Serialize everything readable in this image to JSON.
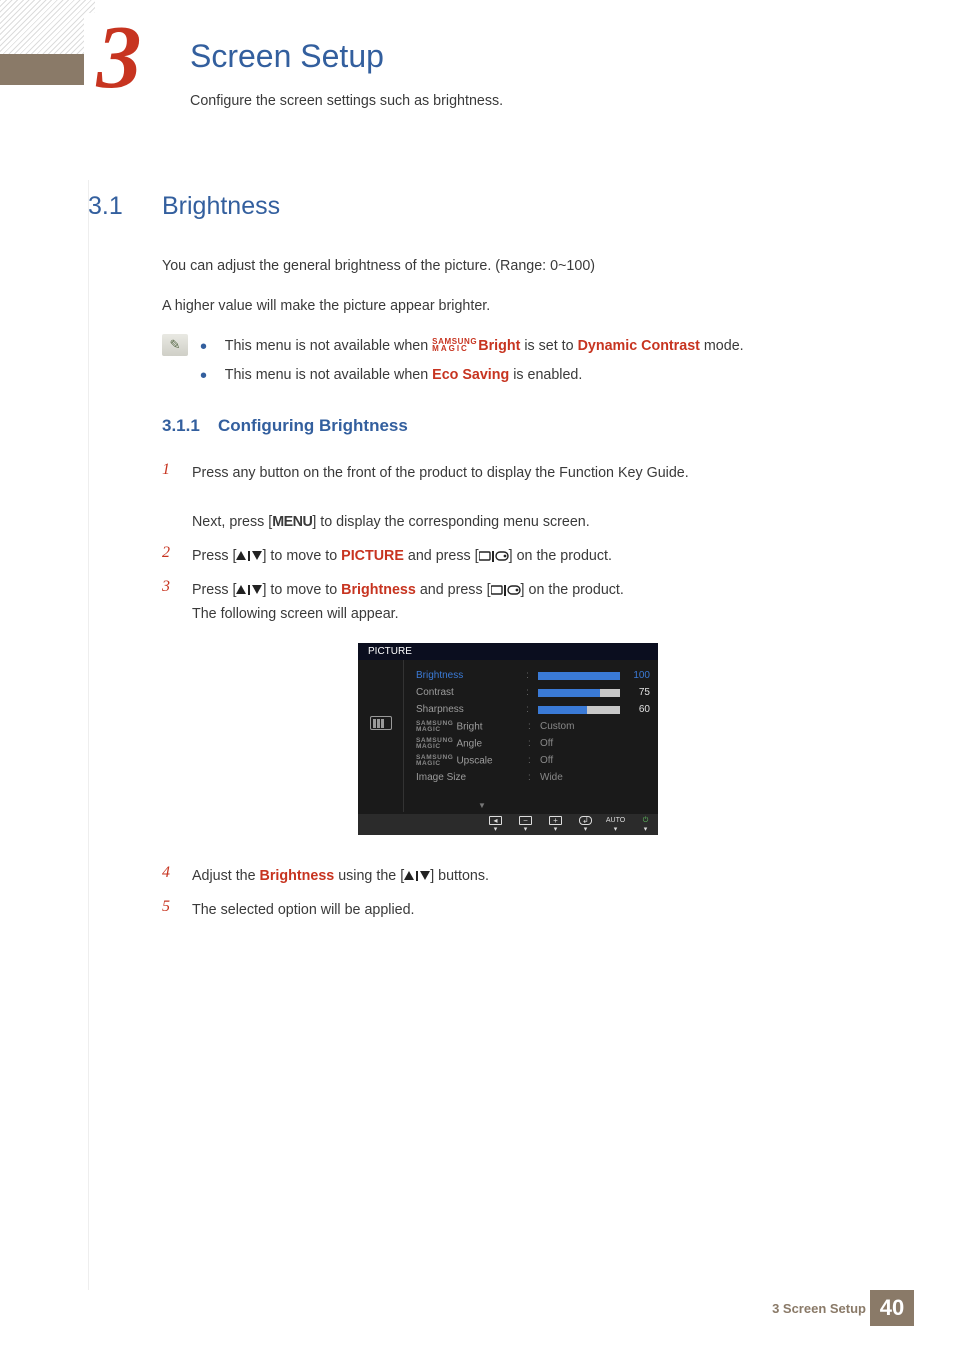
{
  "chapter": {
    "number": "3",
    "title": "Screen Setup",
    "subtitle": "Configure the screen settings such as brightness."
  },
  "section": {
    "number": "3.1",
    "title": "Brightness"
  },
  "para1": "You can adjust the general brightness of the picture. (Range: 0~100)",
  "para2": "A higher value will make the picture appear brighter.",
  "notes": {
    "n1a": "This menu is not available when ",
    "n1_bright": "Bright",
    "n1b": " is set to ",
    "n1_dyn": "Dynamic Contrast",
    "n1c": " mode.",
    "n2a": "This menu is not available when ",
    "n2_eco": "Eco Saving",
    "n2b": " is enabled."
  },
  "subsec": {
    "number": "3.1.1",
    "title": "Configuring Brightness"
  },
  "steps": {
    "s1a": "Press any button on the front of the product to display the Function Key Guide.",
    "s1b_pre": "Next, press [",
    "s1b_menu": "MENU",
    "s1b_post": "] to display the corresponding menu screen.",
    "s2_pre": "Press [",
    "s2_mid": "] to move to ",
    "s2_pic": "PICTURE",
    "s2_and": " and press [",
    "s2_post": "] on the product.",
    "s3_pre": "Press [",
    "s3_mid": "] to move to ",
    "s3_bri": "Brightness",
    "s3_and": " and press [",
    "s3_post": "] on the product.",
    "s3_foll": "The following screen will appear.",
    "s4_pre": "Adjust the ",
    "s4_bri": "Brightness",
    "s4_mid": " using the [",
    "s4_post": "] buttons.",
    "s5": "The selected option will be applied."
  },
  "osd": {
    "title": "PICTURE",
    "rows": {
      "brightness": {
        "label": "Brightness",
        "value": "100",
        "fill": 100
      },
      "contrast": {
        "label": "Contrast",
        "value": "75",
        "fill": 75
      },
      "sharpness": {
        "label": "Sharpness",
        "value": "60",
        "fill": 60
      },
      "mbright": {
        "suffix": "Bright",
        "value": "Custom"
      },
      "mangle": {
        "suffix": "Angle",
        "value": "Off"
      },
      "mupscale": {
        "suffix": "Upscale",
        "value": "Off"
      },
      "imgsize": {
        "label": "Image Size",
        "value": "Wide"
      }
    },
    "auto": "AUTO"
  },
  "footer": {
    "text": "3 Screen Setup",
    "page": "40"
  },
  "magic": {
    "top": "SAMSUNG",
    "bot": "MAGIC"
  }
}
